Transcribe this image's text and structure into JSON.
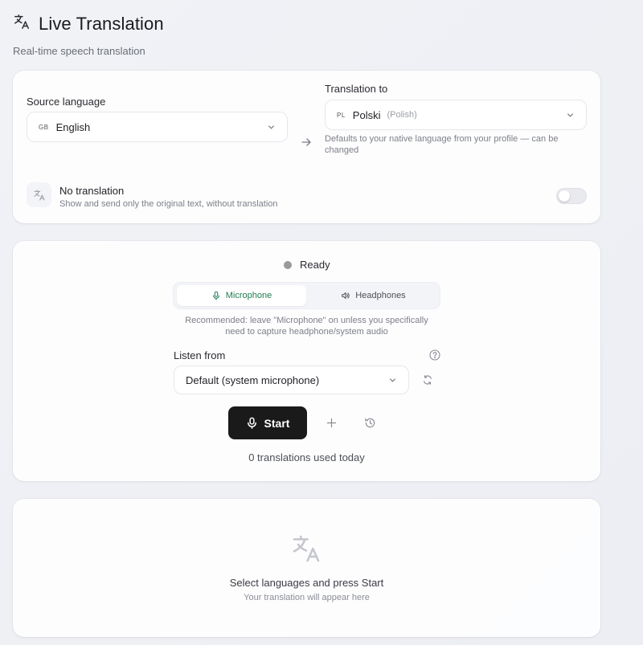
{
  "header": {
    "title": "Live Translation",
    "subtitle": "Real-time speech translation",
    "icon": "translate-icon"
  },
  "languages": {
    "source_label": "Source language",
    "source_code": "GB",
    "source_value": "English",
    "target_label": "Translation to",
    "target_code": "PL",
    "target_value": "Polski",
    "target_native": "(Polish)",
    "target_hint": "Defaults to your native language from your profile — can be changed"
  },
  "no_translation": {
    "title": "No translation",
    "description": "Show and send only the original text, without translation",
    "enabled": false
  },
  "session": {
    "status": "Ready",
    "status_color": "#9a9a9a",
    "modes": [
      {
        "label": "Microphone",
        "active": true
      },
      {
        "label": "Headphones",
        "active": false
      }
    ],
    "recommendation": "Recommended: leave \"Microphone\" on unless you specifically need to capture headphone/system audio",
    "listen_label": "Listen from",
    "listen_value": "Default (system microphone)",
    "start_label": "Start",
    "usage_text": "0 translations used today"
  },
  "output": {
    "empty_title": "Select languages and press Start",
    "empty_subtitle": "Your translation will appear here"
  },
  "colors": {
    "accent": "#1e7d52",
    "start_button": "#1a1a1a"
  }
}
